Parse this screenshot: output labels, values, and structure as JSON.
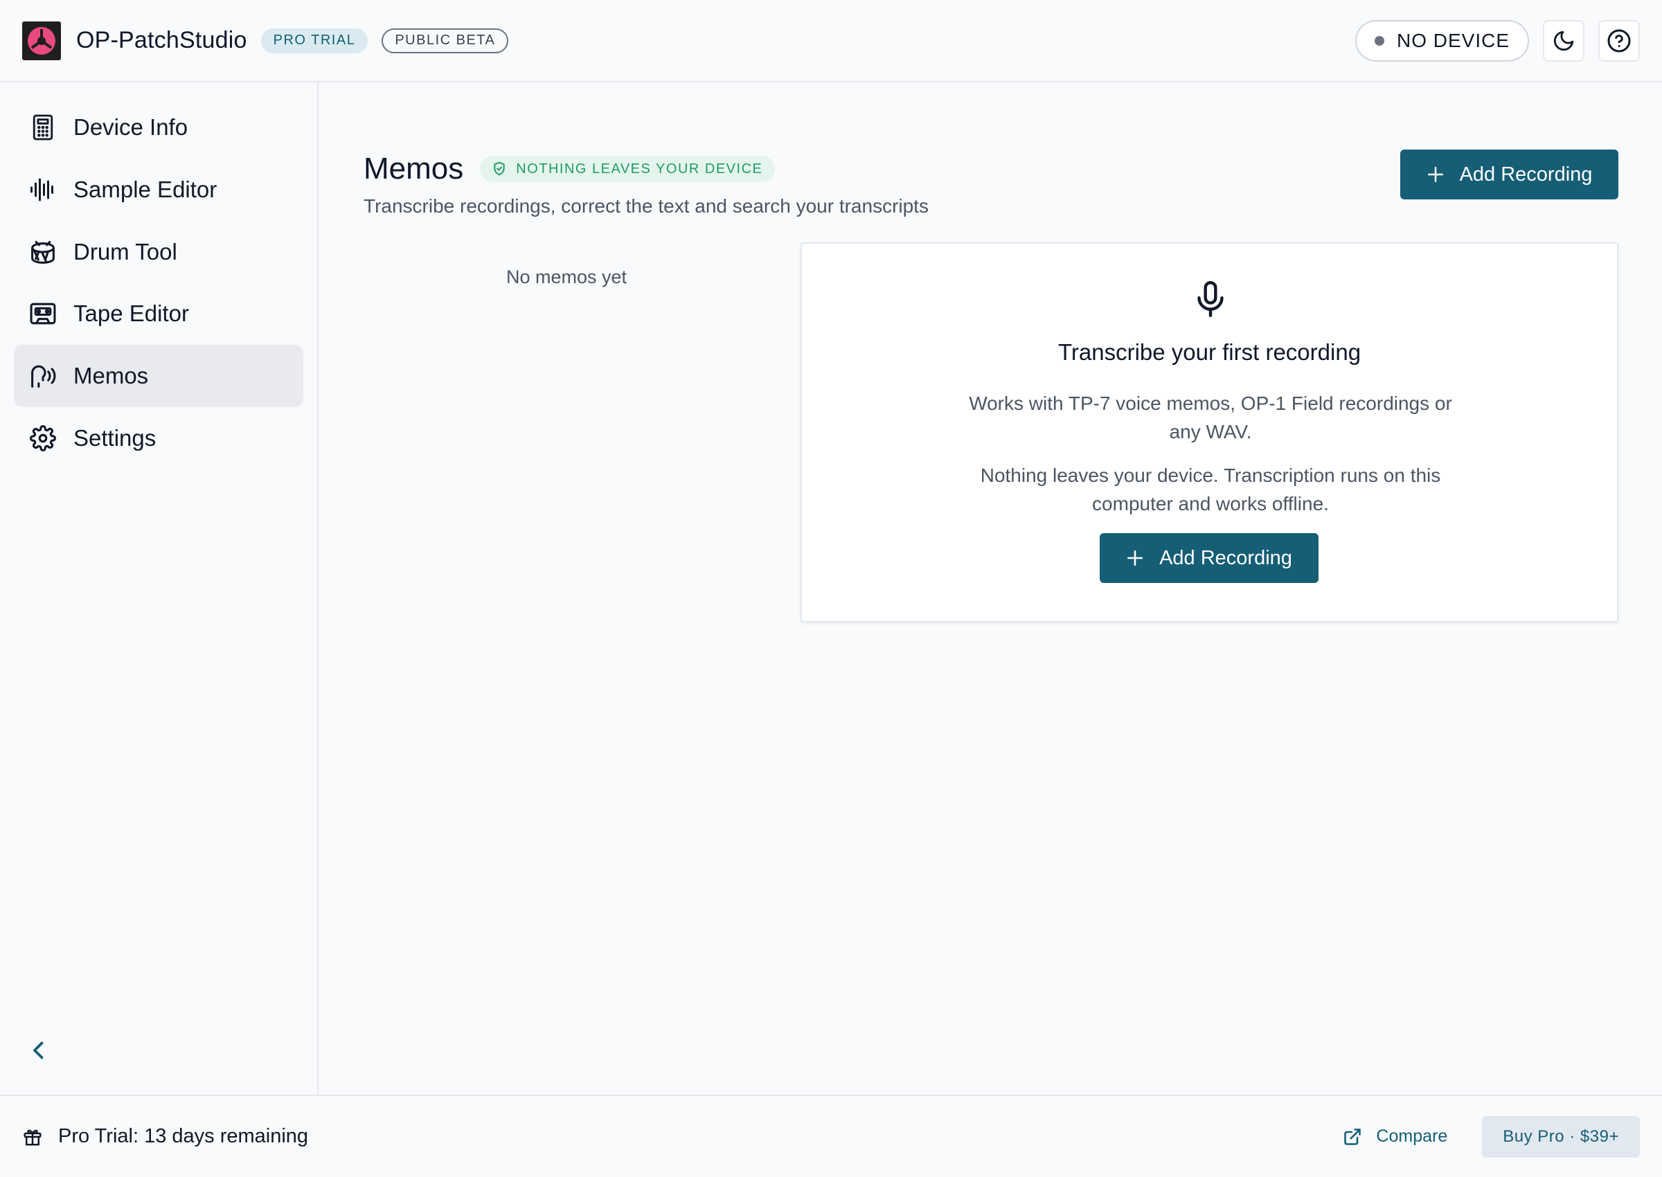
{
  "header": {
    "app_title": "OP-PatchStudio",
    "badge_pro": "PRO TRIAL",
    "badge_beta": "PUBLIC BETA",
    "device_status": "NO DEVICE",
    "theme_icon": "moon-icon",
    "help_icon": "help-circle-icon"
  },
  "sidebar": {
    "items": [
      {
        "label": "Device Info",
        "icon": "device-info-icon"
      },
      {
        "label": "Sample Editor",
        "icon": "waveform-icon"
      },
      {
        "label": "Drum Tool",
        "icon": "drum-icon"
      },
      {
        "label": "Tape Editor",
        "icon": "cassette-tape-icon"
      },
      {
        "label": "Memos",
        "icon": "speaking-head-icon",
        "active": true
      },
      {
        "label": "Settings",
        "icon": "gear-icon"
      }
    ],
    "collapse_icon": "chevron-left-icon"
  },
  "main": {
    "title": "Memos",
    "privacy_badge": "NOTHING LEAVES YOUR DEVICE",
    "subtitle": "Transcribe recordings, correct the text and search your transcripts",
    "add_button": "Add Recording",
    "empty_list": "No memos yet",
    "empty_card": {
      "title": "Transcribe your first recording",
      "line1": "Works with TP-7 voice memos, OP-1 Field recordings or any WAV.",
      "line2": "Nothing leaves your device. Transcription runs on this computer and works offline.",
      "button": "Add Recording"
    }
  },
  "footer": {
    "trial_text": "Pro Trial: 13 days remaining",
    "compare_label": "Compare",
    "buy_label": "Buy Pro · $39+"
  },
  "colors": {
    "accent": "#155e75",
    "background": "#f8fafc",
    "success_green": "#1f9a6b",
    "logo_pink": "#e84a7f"
  }
}
